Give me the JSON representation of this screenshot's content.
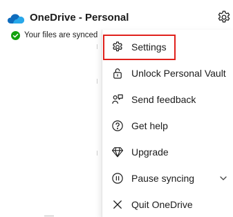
{
  "header": {
    "title": "OneDrive - Personal",
    "status": "Your files are synced",
    "cloud_icon": "onedrive-cloud-icon",
    "settings_icon": "gear-icon"
  },
  "menu": {
    "items": [
      {
        "label": "Settings",
        "icon": "gear-icon",
        "highlighted": true
      },
      {
        "label": "Unlock Personal Vault",
        "icon": "lock-icon"
      },
      {
        "label": "Send feedback",
        "icon": "feedback-icon"
      },
      {
        "label": "Get help",
        "icon": "help-icon"
      },
      {
        "label": "Upgrade",
        "icon": "diamond-icon"
      },
      {
        "label": "Pause syncing",
        "icon": "pause-icon",
        "has_submenu": true
      },
      {
        "label": "Quit OneDrive",
        "icon": "close-icon"
      }
    ]
  },
  "colors": {
    "highlight": "#e0201b",
    "brand_blue": "#0f6cbd",
    "sync_green": "#13a10e"
  }
}
